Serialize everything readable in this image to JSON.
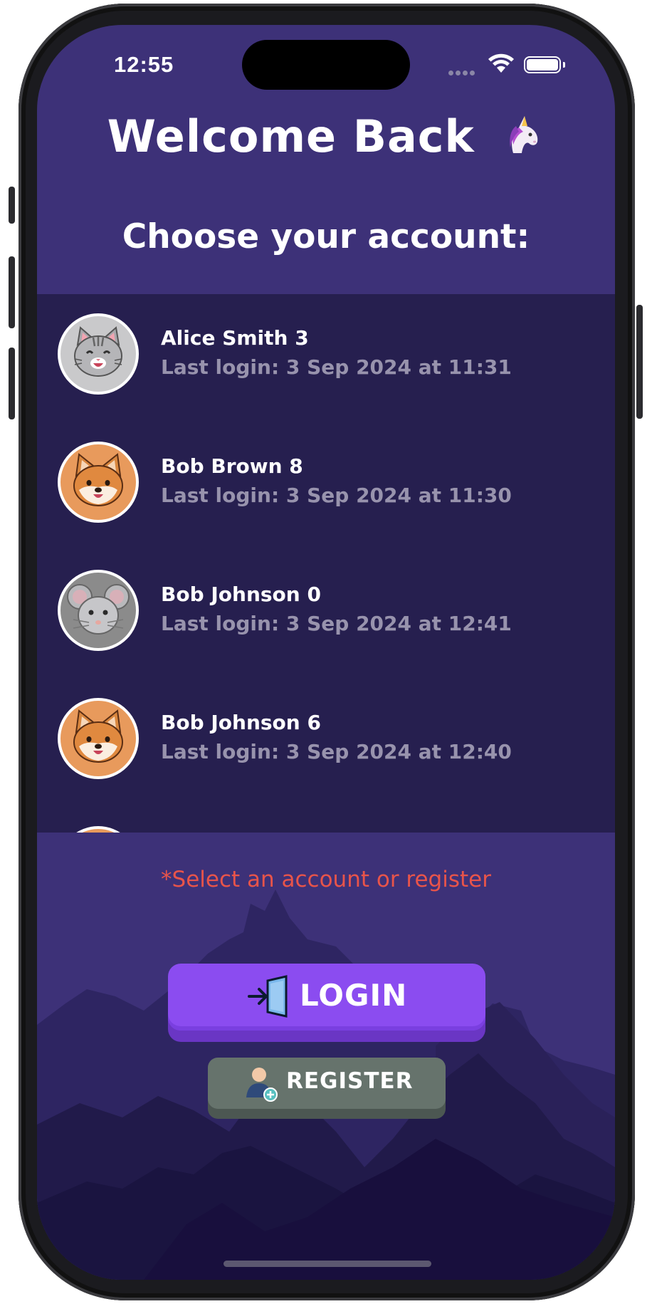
{
  "status_bar": {
    "time": "12:55",
    "icons": [
      "signal-dots-icon",
      "wifi-icon",
      "battery-icon"
    ]
  },
  "header": {
    "title": "Welcome Back",
    "title_emoji": "unicorn-emoji-icon",
    "subtitle": "Choose your account:"
  },
  "accounts": [
    {
      "name": "Alice Smith 3",
      "last_login": "Last login: 3 Sep 2024 at 11:31",
      "avatar": "cat-icon",
      "avatar_bg": "#c9c9cb"
    },
    {
      "name": "Bob Brown 8",
      "last_login": "Last login: 3 Sep 2024 at 11:30",
      "avatar": "shiba-dog-icon",
      "avatar_bg": "#e89a5c"
    },
    {
      "name": "Bob Johnson 0",
      "last_login": "Last login: 3 Sep 2024 at 12:41",
      "avatar": "mouse-icon",
      "avatar_bg": "#8b8b8b"
    },
    {
      "name": "Bob Johnson 6",
      "last_login": "Last login: 3 Sep 2024 at 12:40",
      "avatar": "shiba-dog-icon",
      "avatar_bg": "#e89a5c"
    }
  ],
  "hint": "*Select an account or register",
  "buttons": {
    "login": {
      "label": "LOGIN",
      "icon": "door-enter-icon",
      "color": "#8b4cf0"
    },
    "register": {
      "label": "REGISTER",
      "icon": "add-user-icon",
      "color": "#66736c"
    }
  },
  "colors": {
    "background": "#3d3178",
    "list_bg": "#261f4f",
    "hint": "#e8544a"
  }
}
